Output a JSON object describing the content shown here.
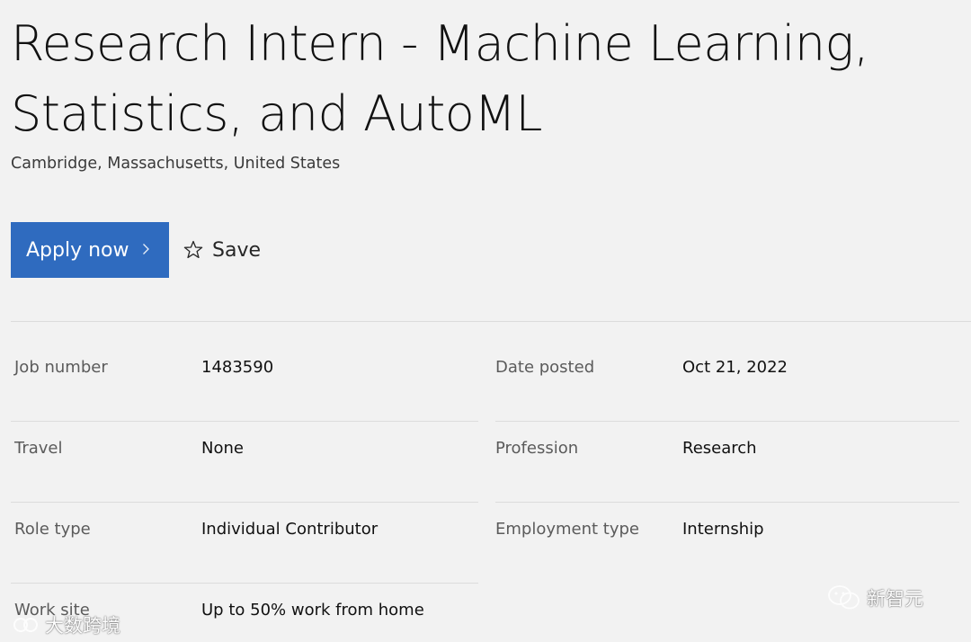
{
  "job": {
    "title": "Research Intern - Machine Learning, Statistics, and AutoML",
    "location": "Cambridge, Massachusetts, United States"
  },
  "actions": {
    "apply_label": "Apply now",
    "save_label": "Save"
  },
  "details": {
    "job_number": {
      "label": "Job number",
      "value": "1483590"
    },
    "date_posted": {
      "label": "Date posted",
      "value": "Oct 21, 2022"
    },
    "travel": {
      "label": "Travel",
      "value": "None"
    },
    "profession": {
      "label": "Profession",
      "value": "Research"
    },
    "role_type": {
      "label": "Role type",
      "value": "Individual Contributor"
    },
    "employment_type": {
      "label": "Employment type",
      "value": "Internship"
    },
    "work_site": {
      "label": "Work site",
      "value": "Up to 50% work from home"
    }
  },
  "watermarks": {
    "left_text": "大数跨境",
    "right_text": "新智元"
  },
  "icons": {
    "apply_chevron": "chevron-right-icon",
    "save_star": "star-outline-icon",
    "watermark_left": "logo-icon",
    "watermark_right": "wechat-icon"
  },
  "colors": {
    "page_background": "#f2f2f2",
    "primary_button": "#2f6bbf",
    "divider": "#dcdcdc",
    "label_text": "#5b5b5b"
  }
}
